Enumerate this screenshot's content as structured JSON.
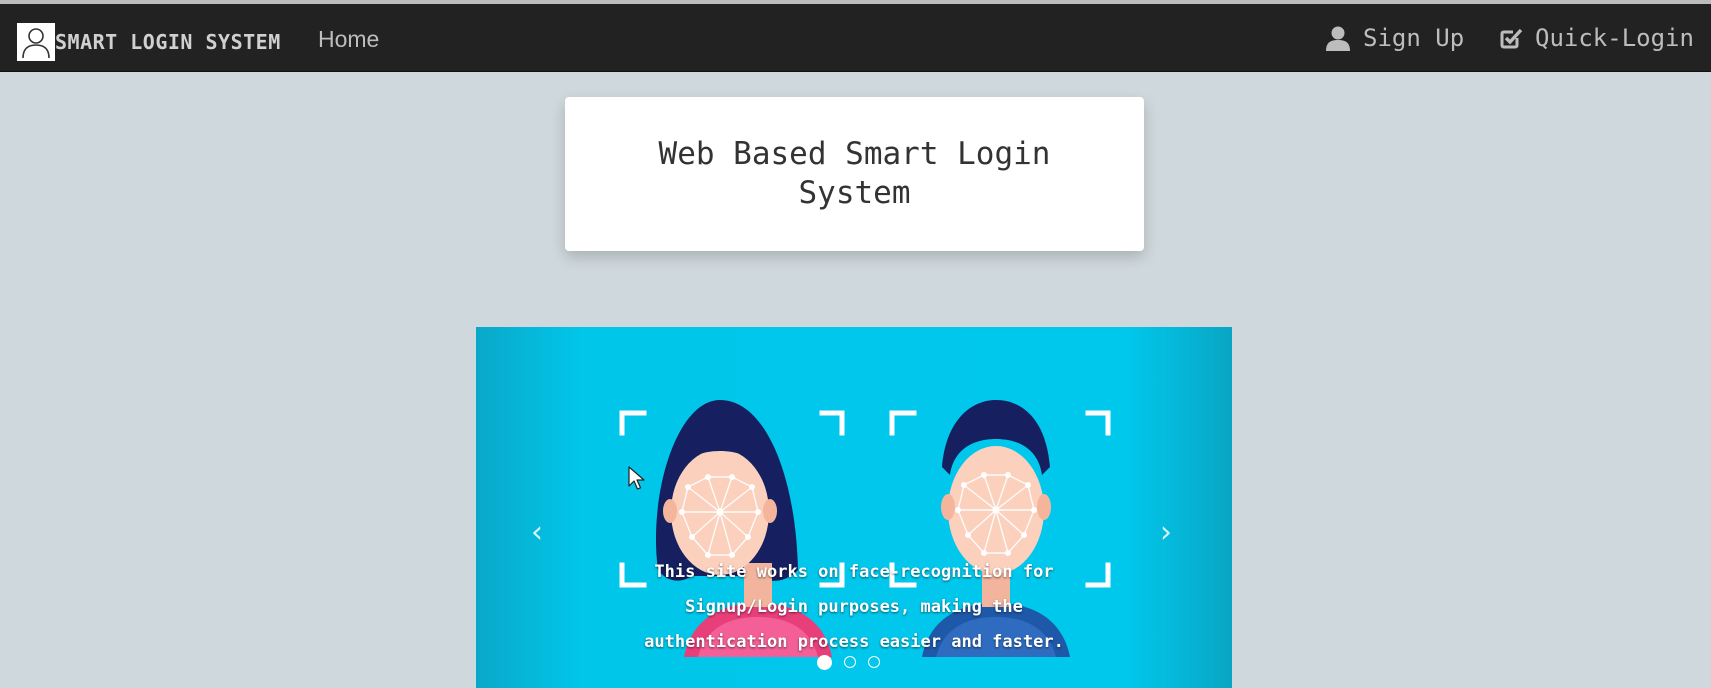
{
  "navbar": {
    "brand": "SMART LOGIN SYSTEM",
    "home": "Home",
    "signup": "Sign Up",
    "quick_login": "Quick-Login",
    "brand_logo_icon": "user-outline-icon",
    "signup_icon": "user-icon",
    "quick_login_icon": "checkbox-checked-icon"
  },
  "title": "Web Based Smart Login System",
  "carousel": {
    "caption": "This site works on face-recognition for Signup/Login purposes, making the authentication process easier and faster.",
    "prev_icon": "chevron-left-icon",
    "next_icon": "chevron-right-icon",
    "active_slide": 1,
    "slide_count": 3
  },
  "colors": {
    "navbar_bg": "#222222",
    "page_bg": "#cfd8dc",
    "carousel_bg": "#00c8ec"
  }
}
